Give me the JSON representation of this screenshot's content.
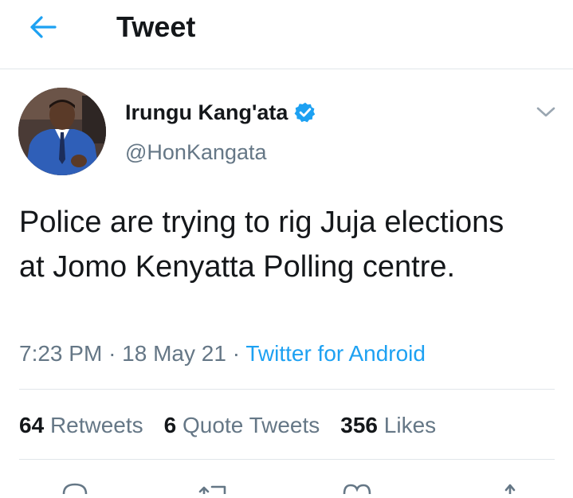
{
  "header": {
    "back_icon": "arrow-left-icon",
    "title": "Tweet"
  },
  "tweet": {
    "author": {
      "name": "Irungu Kang'ata",
      "handle": "@HonKangata",
      "verified_icon": "verified-badge-icon"
    },
    "text": "Police are trying to rig Juja elections at Jomo Kenyatta Polling centre.",
    "time": "7:23 PM",
    "separator": "·",
    "date": "18 May 21",
    "source": "Twitter for Android"
  },
  "stats": {
    "retweets_count": "64",
    "retweets_label": "Retweets",
    "quotes_count": "6",
    "quotes_label": "Quote Tweets",
    "likes_count": "356",
    "likes_label": "Likes"
  },
  "actions": [
    "reply-icon",
    "retweet-icon",
    "like-icon",
    "share-icon"
  ],
  "colors": {
    "accent": "#1da1f2",
    "text": "#14171a",
    "muted": "#657786",
    "divider": "#e1e6ea"
  }
}
